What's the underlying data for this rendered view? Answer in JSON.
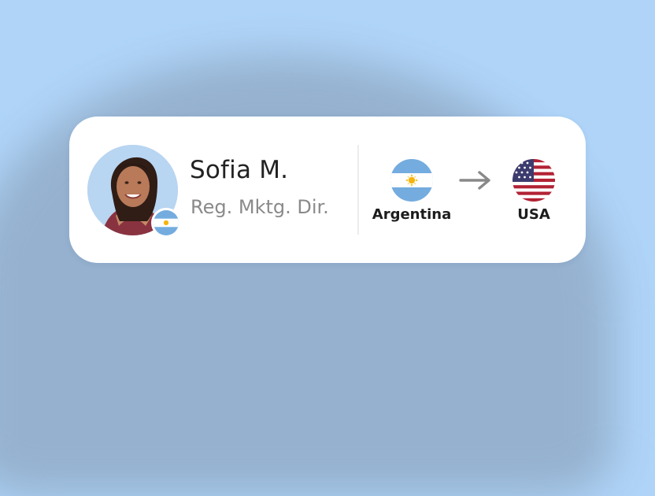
{
  "profile": {
    "name": "Sofia M.",
    "role": "Reg. Mktg. Dir.",
    "avatar_icon": "person-avatar",
    "country_flag_icon": "argentina-flag-icon"
  },
  "relocation": {
    "from_country": "Argentina",
    "to_country": "USA",
    "from_flag_icon": "argentina-flag-icon",
    "to_flag_icon": "usa-flag-icon",
    "arrow_icon": "arrow-right-icon"
  },
  "colors": {
    "background": "#afd4f8",
    "card": "#ffffff",
    "name_text": "#222222",
    "role_text": "#8a8a8a",
    "argentina_blue": "#74acdf",
    "usa_red": "#b22234",
    "usa_blue": "#3c3b6e",
    "arrow": "#888888"
  }
}
